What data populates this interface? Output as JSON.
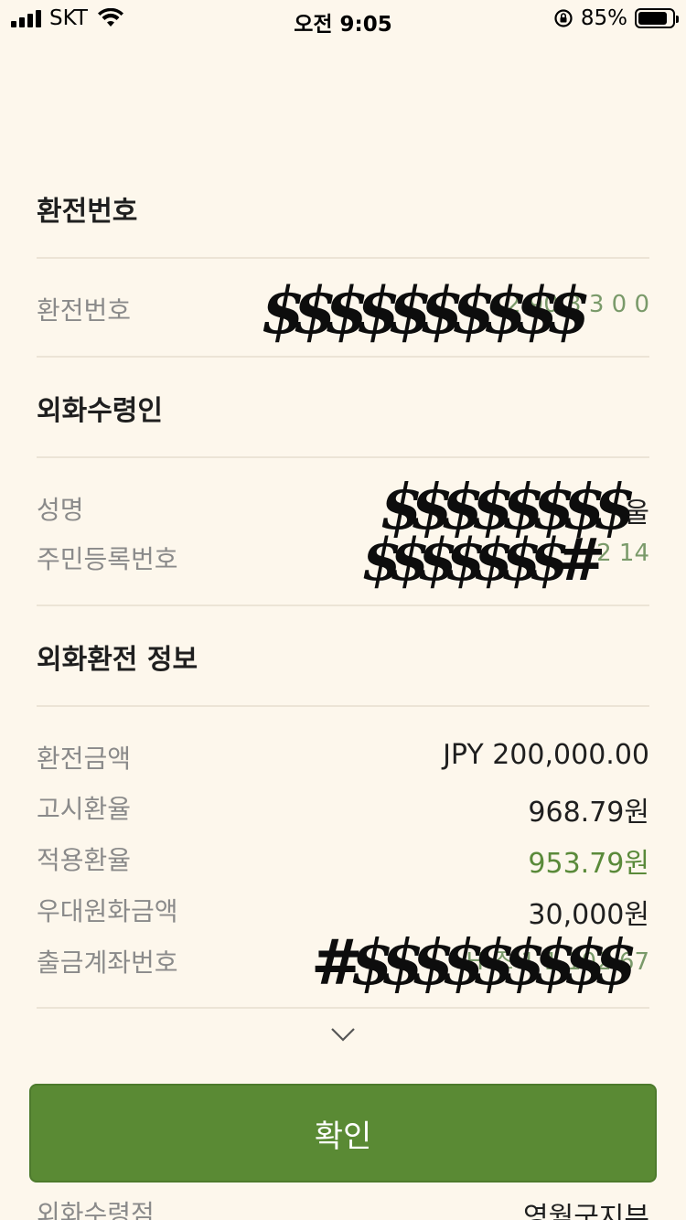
{
  "status_bar": {
    "carrier": "SKT",
    "time": "오전 9:05",
    "battery_percent_label": "85%",
    "battery_level": 0.85
  },
  "sections": {
    "exchange_number": {
      "title": "환전번호",
      "rows": [
        {
          "label": "환전번호",
          "value": "2 90 3 3 0  0"
        }
      ]
    },
    "recipient": {
      "title": "외화수령인",
      "rows": [
        {
          "label": "성명",
          "value": "울"
        },
        {
          "label": "주민등록번호",
          "value": "2  14"
        }
      ]
    },
    "exchange_info": {
      "title": "외화환전 정보",
      "rows": [
        {
          "label": "환전금액",
          "value": "JPY 200,000.00"
        },
        {
          "label": "고시환율",
          "value": "968.79원"
        },
        {
          "label": "적용환율",
          "value": "953.79원",
          "accent": "#5a8a3a"
        },
        {
          "label": "우대원화금액",
          "value": "30,000원"
        },
        {
          "label": "출금계좌번호",
          "value": "H  조 1 1 102 67"
        }
      ]
    }
  },
  "confirm_button_label": "확인",
  "bottom_row": {
    "label": "외화수령점",
    "value": "영월군지부"
  },
  "icons": {
    "expand": "chevron-down-icon",
    "wifi": "wifi-icon",
    "rotation_lock": "rotation-lock-icon",
    "battery": "battery-icon",
    "signal": "signal-icon"
  },
  "colors": {
    "background": "#fdf7ec",
    "primary_button": "#5a8a34",
    "accent_text": "#5a8a3a",
    "label_text": "#8a8a8a"
  }
}
